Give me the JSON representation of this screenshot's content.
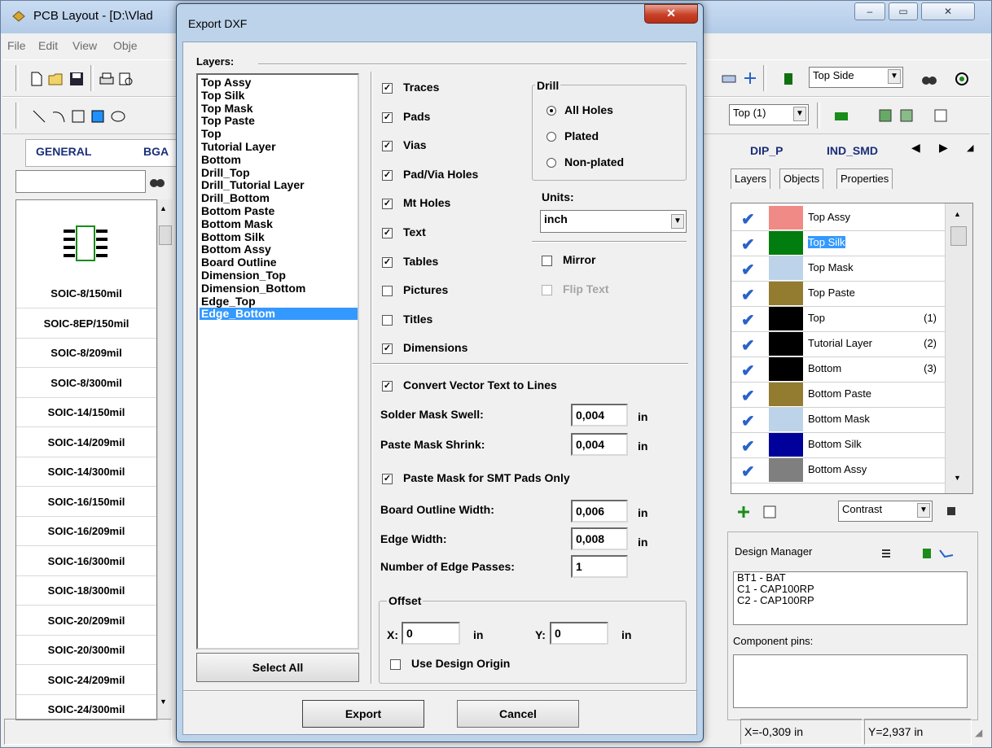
{
  "main_window": {
    "title": "PCB Layout - [D:\\Vlad",
    "menu": [
      "File",
      "Edit",
      "View",
      "Obje"
    ],
    "caption_buttons": [
      "–",
      "▭",
      "✕"
    ],
    "layer_select": "Top Side",
    "layer_select2": "Top (1)",
    "lib_tabs": [
      "GENERAL",
      "BGA",
      "DIP_P",
      "IND_SMD"
    ],
    "library_items": [
      "SOIC-8/150mil",
      "SOIC-8EP/150mil",
      "SOIC-8/209mil",
      "SOIC-8/300mil",
      "SOIC-14/150mil",
      "SOIC-14/209mil",
      "SOIC-14/300mil",
      "SOIC-16/150mil",
      "SOIC-16/209mil",
      "SOIC-16/300mil",
      "SOIC-18/300mil",
      "SOIC-20/209mil",
      "SOIC-20/300mil",
      "SOIC-24/209mil",
      "SOIC-24/300mil"
    ],
    "right_tabs": [
      "Layers",
      "Objects",
      "Properties"
    ],
    "layers": [
      {
        "name": "Top Assy",
        "color": "#f08a86",
        "index": ""
      },
      {
        "name": "Top Silk",
        "color": "#007d0e",
        "index": ""
      },
      {
        "name": "Top Mask",
        "color": "#bcd3ea",
        "index": ""
      },
      {
        "name": "Top Paste",
        "color": "#937b30",
        "index": ""
      },
      {
        "name": "Top",
        "color": "#000000",
        "index": "(1)"
      },
      {
        "name": "Tutorial Layer",
        "color": "#000000",
        "index": "(2)"
      },
      {
        "name": "Bottom",
        "color": "#000000",
        "index": "(3)"
      },
      {
        "name": "Bottom Paste",
        "color": "#937b30",
        "index": ""
      },
      {
        "name": "Bottom Mask",
        "color": "#bcd3ea",
        "index": ""
      },
      {
        "name": "Bottom Silk",
        "color": "#00009a",
        "index": ""
      },
      {
        "name": "Bottom Assy",
        "color": "#7f7f7f",
        "index": ""
      }
    ],
    "contrast_select": "Contrast",
    "design_manager": {
      "label": "Design Manager",
      "items": [
        "BT1 - BAT",
        "C1 - CAP100RP",
        "C2 - CAP100RP"
      ],
      "component_pins_label": "Component pins:"
    },
    "status": {
      "x": "X=-0,309 in",
      "y": "Y=2,937 in"
    }
  },
  "dialog": {
    "title": "Export DXF",
    "close_glyph": "✕",
    "layers_label": "Layers:",
    "layers": [
      "Top Assy",
      "Top Silk",
      "Top Mask",
      "Top Paste",
      "Top",
      "Tutorial Layer",
      "Bottom",
      "Drill_Top",
      "Drill_Tutorial Layer",
      "Drill_Bottom",
      "Bottom Paste",
      "Bottom Mask",
      "Bottom Silk",
      "Bottom Assy",
      "Board Outline",
      "Dimension_Top",
      "Dimension_Bottom",
      "Edge_Top",
      "Edge_Bottom"
    ],
    "selected_layer": "Edge_Bottom",
    "select_all": "Select All",
    "objects": [
      {
        "label": "Traces",
        "checked": true
      },
      {
        "label": "Pads",
        "checked": true
      },
      {
        "label": "Vias",
        "checked": true
      },
      {
        "label": "Pad/Via Holes",
        "checked": true
      },
      {
        "label": "Mt Holes",
        "checked": true
      },
      {
        "label": "Text",
        "checked": true
      },
      {
        "label": "Tables",
        "checked": true
      },
      {
        "label": "Pictures",
        "checked": false
      },
      {
        "label": "Titles",
        "checked": false
      },
      {
        "label": "Dimensions",
        "checked": true
      }
    ],
    "drill": {
      "label": "Drill",
      "options": [
        {
          "label": "All Holes",
          "selected": true
        },
        {
          "label": "Plated",
          "selected": false
        },
        {
          "label": "Non-plated",
          "selected": false
        }
      ]
    },
    "units_label": "Units:",
    "units_value": "inch",
    "mirror": {
      "label": "Mirror",
      "checked": false
    },
    "flip_text": {
      "label": "Flip Text",
      "checked": false,
      "disabled": true
    },
    "convert_vector": {
      "label": "Convert Vector Text to Lines",
      "checked": true
    },
    "solder_mask_swell": {
      "label": "Solder Mask Swell:",
      "value": "0,004",
      "unit": "in"
    },
    "paste_mask_shrink": {
      "label": "Paste Mask Shrink:",
      "value": "0,004",
      "unit": "in"
    },
    "paste_mask_smt": {
      "label": "Paste Mask for SMT Pads Only",
      "checked": true
    },
    "board_outline_width": {
      "label": "Board Outline Width:",
      "value": "0,006",
      "unit": "in"
    },
    "edge_width": {
      "label": "Edge Width:",
      "value": "0,008",
      "unit": "in"
    },
    "edge_passes": {
      "label": "Number of Edge Passes:",
      "value": "1"
    },
    "offset": {
      "label": "Offset",
      "x_label": "X:",
      "x_value": "0",
      "x_unit": "in",
      "y_label": "Y:",
      "y_value": "0",
      "y_unit": "in",
      "use_origin": {
        "label": "Use Design Origin",
        "checked": false
      }
    },
    "export_button": "Export",
    "cancel_button": "Cancel"
  }
}
